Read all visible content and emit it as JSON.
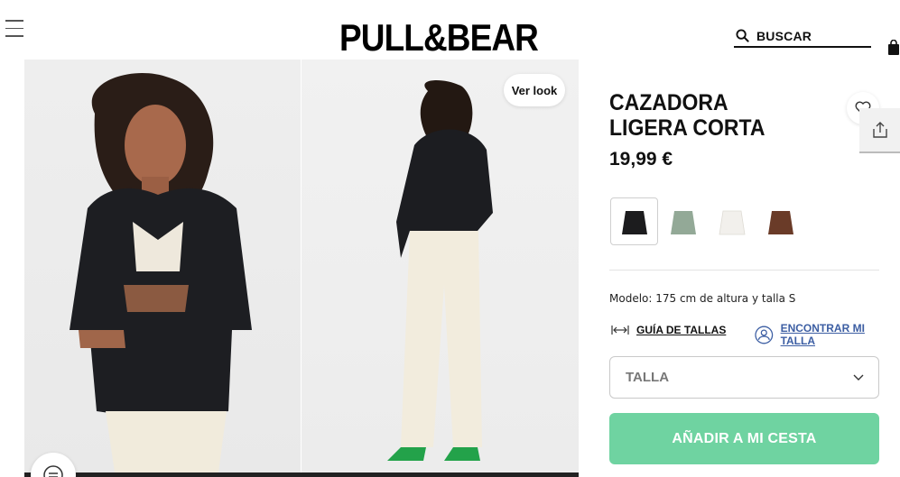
{
  "header": {
    "logo": "PULL&BEAR",
    "search_placeholder": "BUSCAR"
  },
  "gallery": {
    "ver_look_label": "Ver look"
  },
  "product": {
    "title": "CAZADORA LIGERA CORTA",
    "price": "19,99 €",
    "colors": [
      {
        "name": "black",
        "hex": "#1c1c1e",
        "selected": true
      },
      {
        "name": "sage-green",
        "hex": "#93a997",
        "selected": false
      },
      {
        "name": "white",
        "hex": "#f2f0ec",
        "selected": false
      },
      {
        "name": "brown",
        "hex": "#6a3b28",
        "selected": false
      }
    ],
    "model_info": "Modelo: 175 cm de altura y talla S",
    "size_guide_label": "GUÍA DE TALLAS",
    "find_size_label": "ENCONTRAR MI TALLA",
    "size_select_placeholder": "TALLA",
    "add_to_cart_label": "AÑADIR A MI CESTA"
  },
  "colors": {
    "accent_green": "#6fd3a1",
    "link_blue": "#3c5ea3"
  }
}
